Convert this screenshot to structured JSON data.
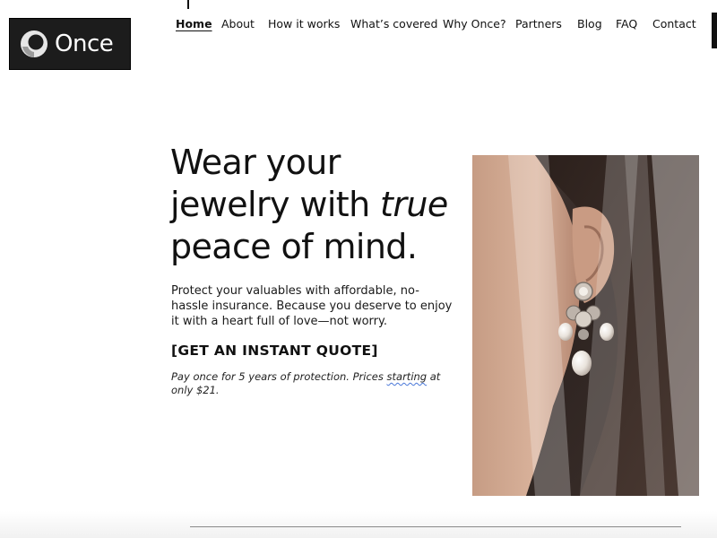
{
  "brand": {
    "name": "Once",
    "logo_icon": "once-logo-mark"
  },
  "nav": {
    "items": [
      {
        "label": "Home",
        "active": true
      },
      {
        "label": "About"
      },
      {
        "label": "How it works"
      },
      {
        "label": "What’s covered"
      },
      {
        "label": "Why Once?"
      },
      {
        "label": "Partners"
      },
      {
        "label": "Blog"
      },
      {
        "label": "FAQ"
      },
      {
        "label": "Contact"
      }
    ]
  },
  "hero": {
    "headline_pre": "Wear your jewelry with ",
    "headline_em": "true",
    "headline_post": " peace of mind.",
    "intro": "Protect your valuables with affordable, no-hassle insurance. Because you deserve to enjoy it with a heart full of love—not worry.",
    "cta_label": "[GET AN INSTANT QUOTE]",
    "pricing_pre": "Pay once for 5 years of protection. Prices ",
    "pricing_flagged": "starting",
    "pricing_post": " at only $21."
  },
  "colors": {
    "logo_bg": "#1c1c1c",
    "text": "#111111",
    "spellcheck_underline": "#4a78d8"
  }
}
